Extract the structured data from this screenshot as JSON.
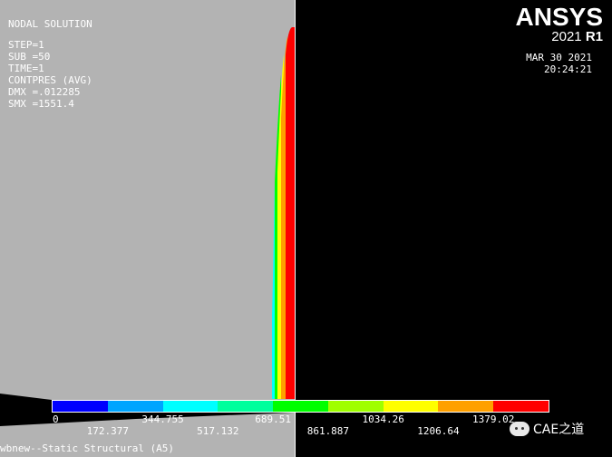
{
  "plot": {
    "title": "NODAL SOLUTION",
    "info_lines": [
      "STEP=1",
      "SUB =50",
      "TIME=1",
      "CONTPRES (AVG)",
      "DMX =.012285",
      "SMX =1551.4"
    ]
  },
  "logo": {
    "brand": "ANSYS",
    "version": "2021",
    "release": "R1"
  },
  "timestamp": {
    "date": "MAR 30 2021",
    "time": "20:24:21"
  },
  "legend": {
    "colors": [
      "#0000ff",
      "#00a5ff",
      "#00ffff",
      "#00ff9c",
      "#00ff00",
      "#a0ff00",
      "#ffff00",
      "#ffa000",
      "#ff0000"
    ],
    "labels_top": [
      "0",
      "344.755",
      "689.51",
      "1034.26",
      "1379.02"
    ],
    "labels_bottom": [
      "172.377",
      "517.132",
      "861.887",
      "1206.64"
    ]
  },
  "footer": {
    "text": "wbnew--Static Structural (A5)"
  },
  "watermark": {
    "text": "CAE之道"
  },
  "colors": {
    "background": "#000000",
    "model_gray": "#b3b3b3",
    "text": "#ffffff"
  }
}
